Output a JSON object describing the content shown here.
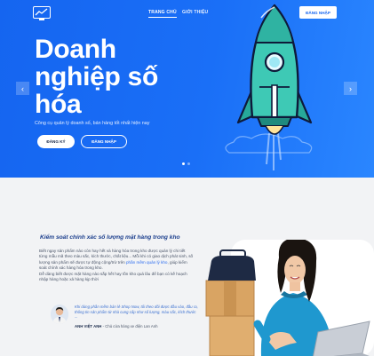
{
  "header": {
    "nav": [
      {
        "label": "TRANG CHỦ"
      },
      {
        "label": "GIỚI THIỆU"
      }
    ],
    "login_label": "ĐĂNG NHẬP"
  },
  "hero": {
    "title": "Doanh nghiệp số hóa",
    "subtitle": "Công cụ quản lý doanh số, bán hàng tốt nhất hiện nay",
    "register_label": "ĐĂNG KÝ",
    "login_label": "ĐĂNG NHẬP",
    "prev_icon": "‹",
    "next_icon": "›",
    "slides_total": 2,
    "slide_active": 1
  },
  "feature": {
    "title": "Kiểm soát chính xác số lượng mặt hàng trong kho",
    "body_1": "Biết ngay sản phẩm nào còn hay hết và hàng hóa trong kho được quản lý chi tiết từng mẫu mã theo màu sắc, kích thước, chất liệu... Mỗi khi có giao dịch phát sinh, số lượng sản phẩm sẽ được tự động cộng/trừ trên ",
    "body_link": "phần mềm quản lý kho",
    "body_2": ", giúp kiểm soát chính xác hàng hóa trong kho.",
    "body_3": "Dễ dàng biết được mặt hàng nào sắp hết hay tồn kho quá lâu để bạn có kế hoạch nhập hàng hoặc xả hàng kịp thời",
    "quote": "Khi dùng phần mềm bán lẻ Shop Now, tôi theo dõi được đầu vào, đầu ra, thông tin sản phẩm từ nhà cung cấp như số lượng, màu sắc, kích thước ...",
    "author_name": "ANH VIỆT ANH",
    "author_role": " - Chủ cửa hàng xe điện Lan Anh"
  },
  "colors": {
    "primary": "#1565f0",
    "accent": "#2a86ff",
    "rocket_teal": "#3ec9b5",
    "heading": "#1a3d8c"
  }
}
